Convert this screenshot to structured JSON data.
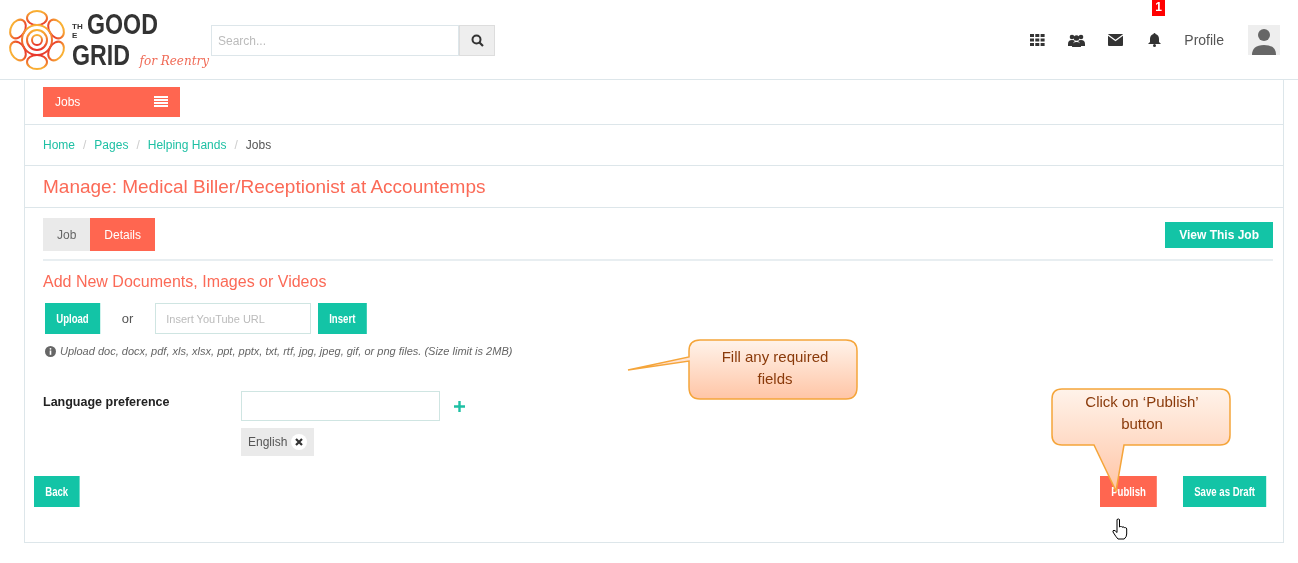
{
  "logo": {
    "line_1": "THE",
    "line_2": "GOOD",
    "line_3": "GRID",
    "tagline": "for Reentry"
  },
  "search": {
    "placeholder": "Search..."
  },
  "nav_icons": [
    {
      "kind": "apps"
    },
    {
      "kind": "people"
    },
    {
      "kind": "mail"
    },
    {
      "kind": "bell",
      "badge": "1"
    }
  ],
  "profile": {
    "label": "Profile"
  },
  "section_menu": {
    "label": "Jobs"
  },
  "breadcrumbs": [
    {
      "label": "Home",
      "current": false
    },
    {
      "separator": "/",
      "label": "Pages",
      "current": false
    },
    {
      "separator": "/",
      "label": "Helping Hands",
      "current": false
    },
    {
      "separator": "/",
      "label": "Jobs",
      "current": true
    }
  ],
  "page_title": "Manage: Medical Biller/Receptionist at Accountemps",
  "tabs": [
    {
      "label": "Job",
      "selected": false
    },
    {
      "label": "Details",
      "selected": true
    }
  ],
  "view_button": "View This Job",
  "media": {
    "heading": "Add New Documents, Images or Videos",
    "upload_button": "Upload",
    "or": "or",
    "url_placeholder": "Insert YouTube URL",
    "insert_button": "Insert",
    "hint": "Upload doc, docx, pdf, xls, xlsx, ppt, pptx, txt, rtf, jpg, jpeg, gif, or png files. (Size limit is 2MB)"
  },
  "language": {
    "label": "Language preference",
    "tags": [
      "English"
    ]
  },
  "buttons": {
    "back": "Back",
    "publish": "Publish",
    "draft": "Save as Draft"
  },
  "callouts": [
    {
      "text": "Fill any required fields",
      "kind": "left"
    },
    {
      "text": "Click on ‘Publish’ button",
      "kind": "down"
    }
  ]
}
